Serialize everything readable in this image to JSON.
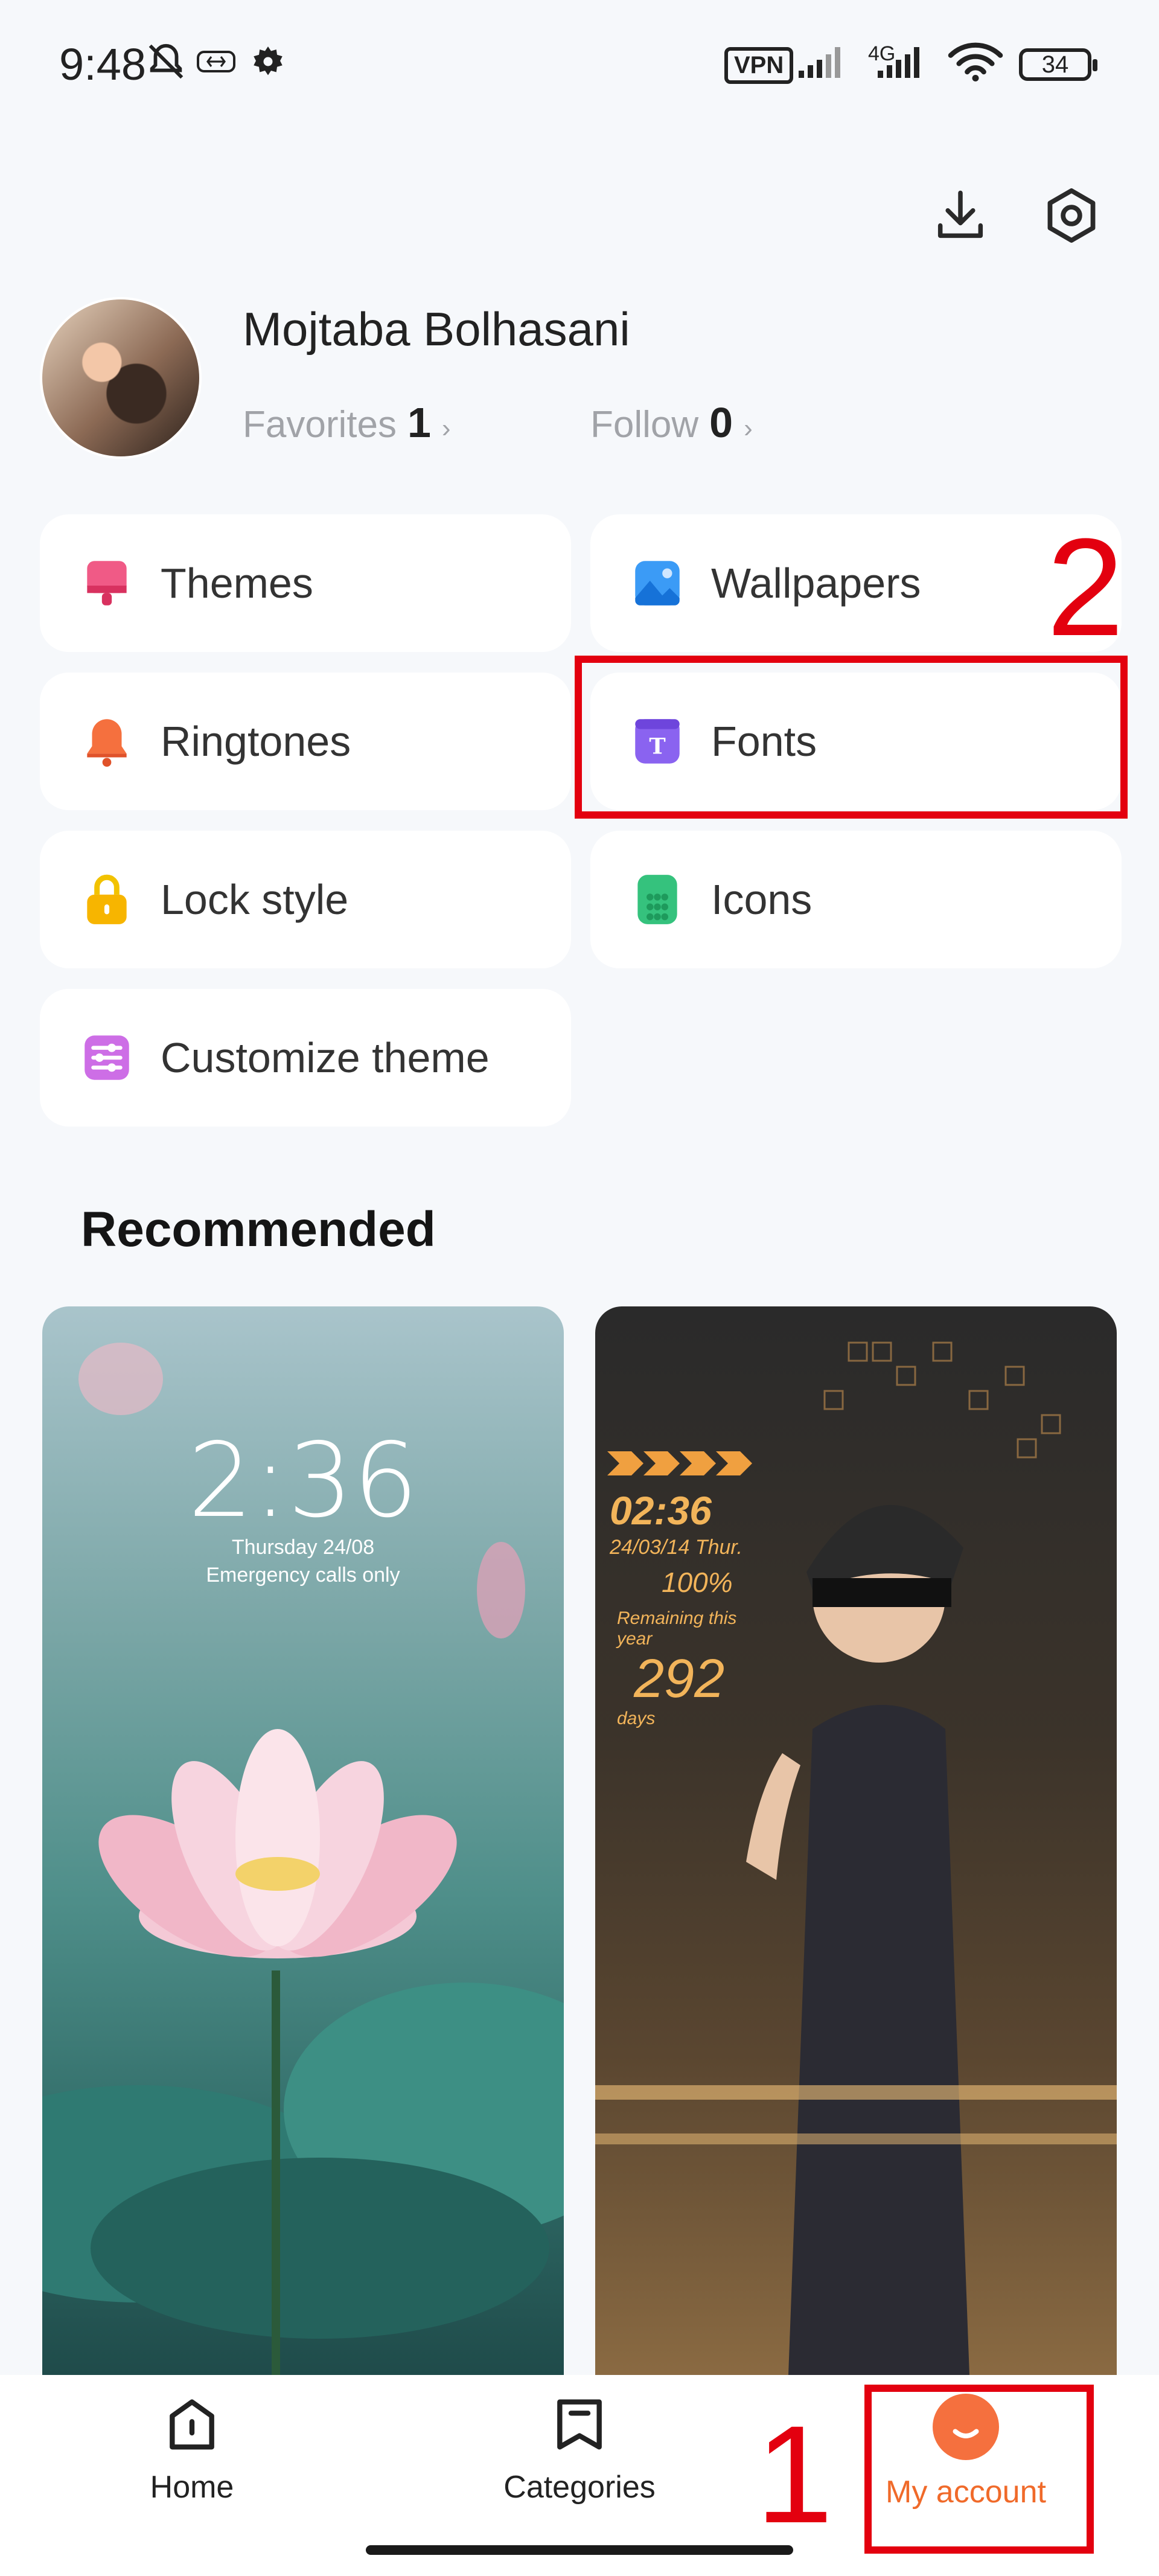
{
  "status_bar": {
    "time": "9:48",
    "vpn": "VPN",
    "network": "4G",
    "battery": "34"
  },
  "profile": {
    "name": "Mojtaba Bolhasani",
    "favorites_label": "Favorites",
    "favorites_count": "1",
    "follow_label": "Follow",
    "follow_count": "0"
  },
  "categories": [
    {
      "label": "Themes",
      "icon": "theme-icon",
      "color": "#ec3f6b"
    },
    {
      "label": "Wallpapers",
      "icon": "wallpaper-icon",
      "color": "#2f8ff2"
    },
    {
      "label": "Ringtones",
      "icon": "bell-icon",
      "color": "#f4683a"
    },
    {
      "label": "Fonts",
      "icon": "font-icon",
      "color": "#7e58e8"
    },
    {
      "label": "Lock style",
      "icon": "lock-icon",
      "color": "#f5b400"
    },
    {
      "label": "Icons",
      "icon": "grid-icon",
      "color": "#2db873"
    },
    {
      "label": "Customize theme",
      "icon": "sliders-icon",
      "color": "#c362df"
    }
  ],
  "recommended": {
    "title": "Recommended",
    "items": [
      {
        "lock_time": "2:36",
        "date": "Thursday 24/08",
        "note": "Emergency calls only"
      },
      {
        "lock_time": "02:36",
        "date": "24/03/14 Thur.",
        "battery": "100%",
        "remaining_label": "Remaining this year",
        "remaining": "292",
        "unit": "days"
      }
    ]
  },
  "nav": {
    "items": [
      {
        "label": "Home",
        "icon": "home-icon"
      },
      {
        "label": "Categories",
        "icon": "categories-icon"
      },
      {
        "label": "My account",
        "icon": "account-icon"
      }
    ],
    "active_color": "#f06a2a"
  },
  "annotations": {
    "step1": "1",
    "step2": "2"
  }
}
